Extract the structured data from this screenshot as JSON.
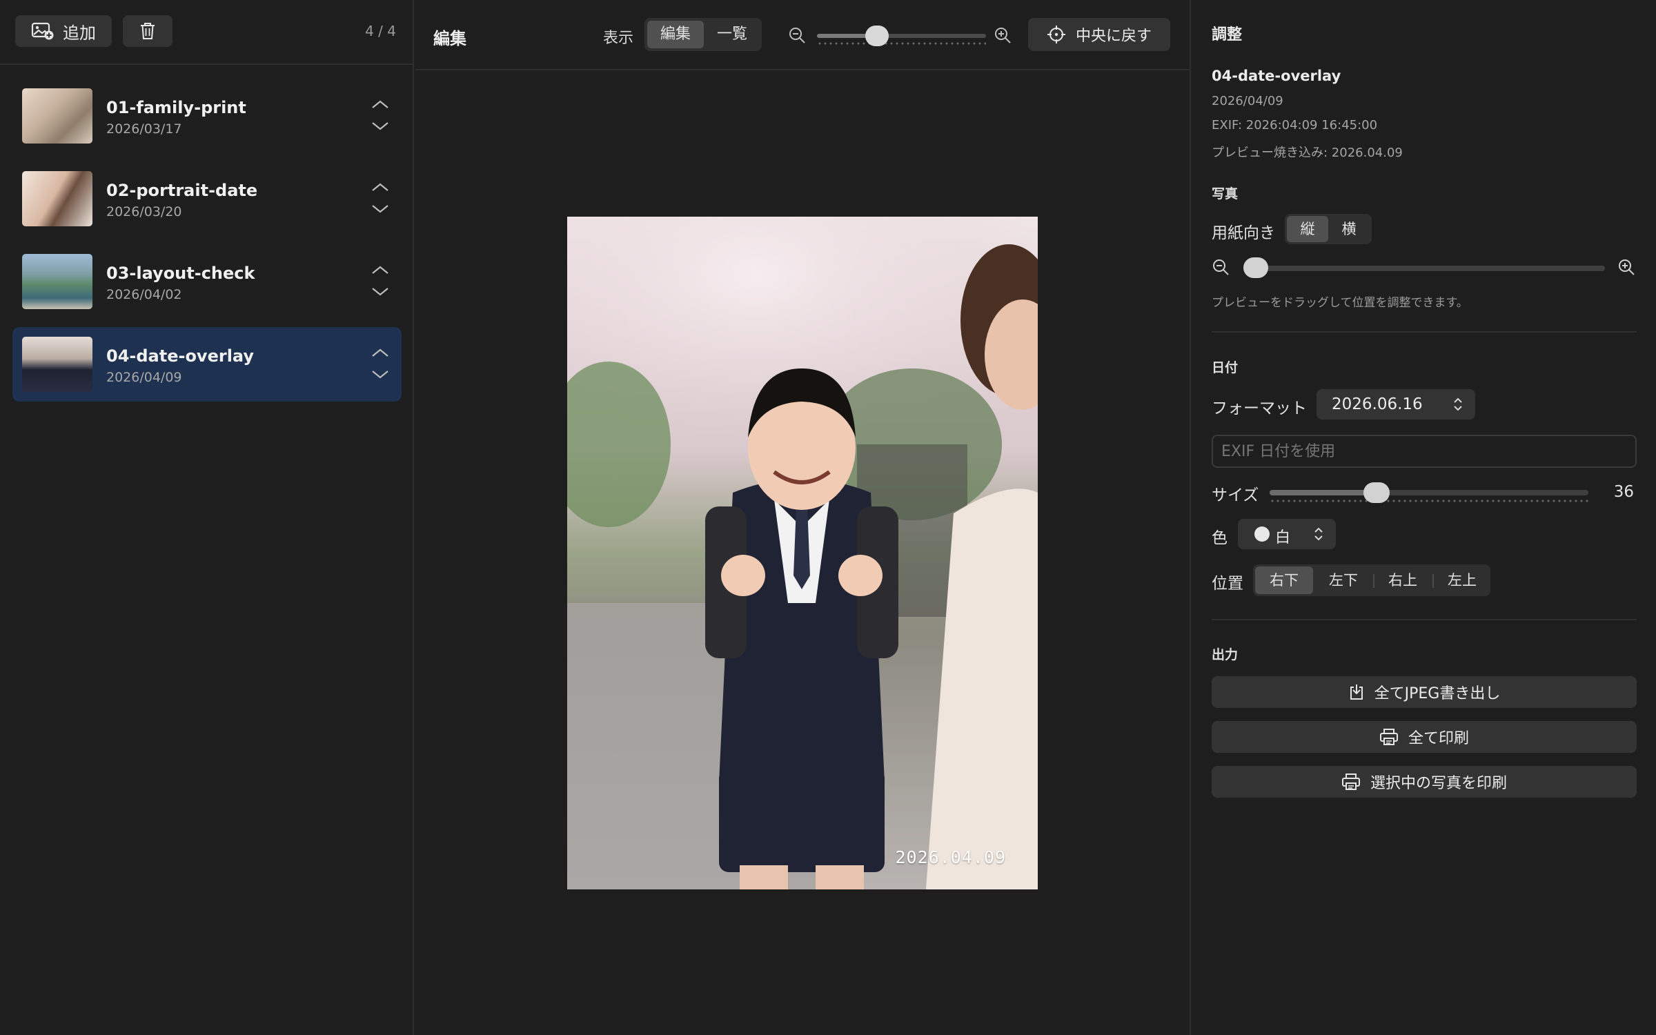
{
  "sidebar": {
    "add_label": "追加",
    "count": "4 / 4",
    "items": [
      {
        "name": "01-family-print",
        "date": "2026/03/17"
      },
      {
        "name": "02-portrait-date",
        "date": "2026/03/20"
      },
      {
        "name": "03-layout-check",
        "date": "2026/04/02"
      },
      {
        "name": "04-date-overlay",
        "date": "2026/04/09"
      }
    ],
    "selected_index": 3
  },
  "center": {
    "title": "編集",
    "view_label": "表示",
    "view_options": [
      "編集",
      "一覧"
    ],
    "view_selected": "編集",
    "zoom_level": 0.33,
    "center_button_label": "中央に戻す",
    "preview_date_overlay": "2026.04.09"
  },
  "panel": {
    "title": "調整",
    "file_name": "04-date-overlay",
    "file_date": "2026/04/09",
    "exif": "EXIF: 2026:04:09 16:45:00",
    "preview_baked": "プレビュー焼き込み: 2026.04.09",
    "photo_section": "写真",
    "orientation_label": "用紙向き",
    "orientation_options": [
      "縦",
      "横"
    ],
    "orientation_selected": "縦",
    "photo_zoom_level": 0.0,
    "drag_hint": "プレビューをドラッグして位置を調整できます。",
    "date_section": "日付",
    "format_label": "フォーマット",
    "format_value": "2026.06.16",
    "exif_placeholder": "EXIF 日付を使用",
    "size_label": "サイズ",
    "size_value": "36",
    "size_level": 0.32,
    "color_label": "色",
    "color_value": "白",
    "position_label": "位置",
    "position_options": [
      "右下",
      "左下",
      "右上",
      "左上"
    ],
    "position_selected": "右下",
    "output_section": "出力",
    "export_jpeg_label": "全てJPEG書き出し",
    "print_all_label": "全て印刷",
    "print_selected_label": "選択中の写真を印刷"
  },
  "colors": {
    "background": "#1e1e1e",
    "selected_row": "#1f3150",
    "control": "#333333",
    "segment_active": "#505050"
  }
}
